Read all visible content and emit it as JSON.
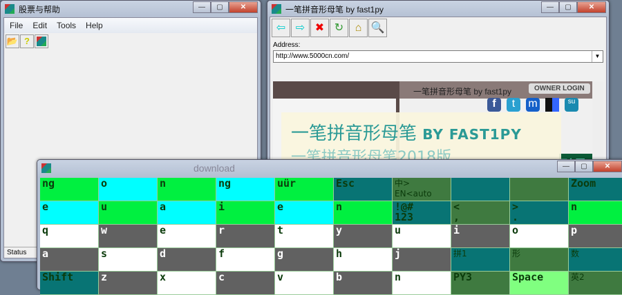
{
  "left_window": {
    "title": "股票与帮助",
    "menu": [
      "File",
      "Edit",
      "Tools",
      "Help"
    ],
    "toolbar": [
      "open-folder-icon",
      "help-icon",
      "app-icon"
    ],
    "status": "Status"
  },
  "browser": {
    "title": "一笔拼音形母笔 by fast1py",
    "toolbar": [
      "back-icon",
      "forward-icon",
      "stop-icon",
      "refresh-icon",
      "home-icon",
      "search-icon"
    ],
    "address_label": "Address:",
    "address": "http://www.5000cn.com/",
    "inner": {
      "title": "一笔拼音形母笔 by fast1py",
      "owner_login": "OWNER LOGIN",
      "social": [
        "f",
        "t",
        "m",
        "d",
        "su"
      ],
      "banner_title": "一笔拼音形母笔",
      "banner_by": "BY FAST1PY",
      "banner_sub": "一笔拼音形母笔2018版",
      "side_text": "形母",
      "download": "download"
    }
  },
  "colors": {
    "green": "#00f040",
    "cyan": "#00ffff",
    "teal": "#087474",
    "dark": "#3f7a40",
    "gray": "#616161",
    "white": "#ffffff",
    "light": "#80ff80"
  },
  "keyboard": {
    "rows": [
      [
        [
          "ng",
          "green"
        ],
        [
          "o",
          "cyan"
        ],
        [
          "n",
          "green"
        ],
        [
          "ng",
          "cyan"
        ],
        [
          "uür",
          "green"
        ],
        [
          "Esc",
          "teal"
        ],
        [
          "中>\nEN<auto",
          "dark"
        ],
        [
          "",
          "teal"
        ],
        [
          "",
          "dark"
        ],
        [
          "Zoom",
          "teal"
        ]
      ],
      [
        [
          "e",
          "cyan"
        ],
        [
          "u",
          "green"
        ],
        [
          "a",
          "cyan"
        ],
        [
          "i",
          "green"
        ],
        [
          "e",
          "cyan"
        ],
        [
          "n",
          "green"
        ],
        [
          "!@#\n123",
          "teal"
        ],
        [
          "<\n,",
          "dark"
        ],
        [
          ">\n.",
          "teal"
        ],
        [
          "n",
          "green"
        ]
      ],
      [
        [
          "q",
          "white"
        ],
        [
          "w",
          "gray"
        ],
        [
          "e",
          "white"
        ],
        [
          "r",
          "gray"
        ],
        [
          "t",
          "white"
        ],
        [
          "y",
          "gray"
        ],
        [
          "u",
          "white"
        ],
        [
          "i",
          "gray"
        ],
        [
          "o",
          "white"
        ],
        [
          "p",
          "gray"
        ]
      ],
      [
        [
          "a",
          "gray"
        ],
        [
          "s",
          "white"
        ],
        [
          "d",
          "gray"
        ],
        [
          "f",
          "white"
        ],
        [
          "g",
          "gray"
        ],
        [
          "h",
          "white"
        ],
        [
          "j",
          "gray"
        ],
        [
          "拼1",
          "teal"
        ],
        [
          "形",
          "dark"
        ],
        [
          "数",
          "teal"
        ]
      ],
      [
        [
          "Shift",
          "teal"
        ],
        [
          "z",
          "gray"
        ],
        [
          "x",
          "white"
        ],
        [
          "c",
          "gray"
        ],
        [
          "v",
          "white"
        ],
        [
          "b",
          "gray"
        ],
        [
          "n",
          "white"
        ],
        [
          "PY3",
          "dark"
        ],
        [
          "Space",
          "light"
        ],
        [
          "英2",
          "dark"
        ]
      ]
    ]
  }
}
